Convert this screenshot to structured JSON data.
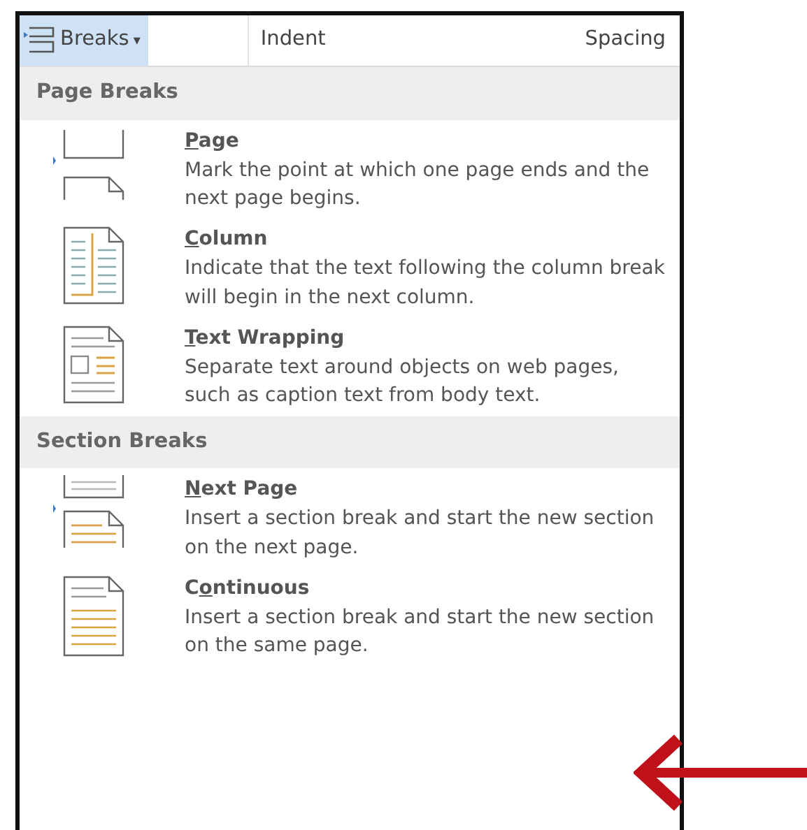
{
  "ribbon": {
    "breaks_button": {
      "label": "Breaks",
      "caret": "▾",
      "selected": true
    },
    "labels": [
      "Indent",
      "Spacing"
    ]
  },
  "sections": [
    {
      "title": "Page Breaks",
      "items": [
        {
          "kind": "page",
          "title": {
            "key": "P",
            "after": "age"
          },
          "description": "Mark the point at which one page ends and the next page begins."
        },
        {
          "kind": "column",
          "title": {
            "key": "C",
            "after": "olumn"
          },
          "description": "Indicate that the text following the column break will begin in the next column."
        },
        {
          "kind": "text-wrapping",
          "title": {
            "key": "T",
            "after": "ext Wrapping"
          },
          "description": "Separate text around objects on web pages, such as caption text from body text."
        }
      ]
    },
    {
      "title": "Section Breaks",
      "items": [
        {
          "kind": "next-page",
          "title": {
            "key": "N",
            "after": "ext Page"
          },
          "description": "Insert a section break and start the new section on the next page."
        },
        {
          "kind": "continuous",
          "title": {
            "before": "C",
            "key": "o",
            "after": "ntinuous"
          },
          "description": "Insert a section break and start the new section on the same page."
        }
      ]
    }
  ],
  "callout_arrow": {
    "color": "#c0101a"
  }
}
